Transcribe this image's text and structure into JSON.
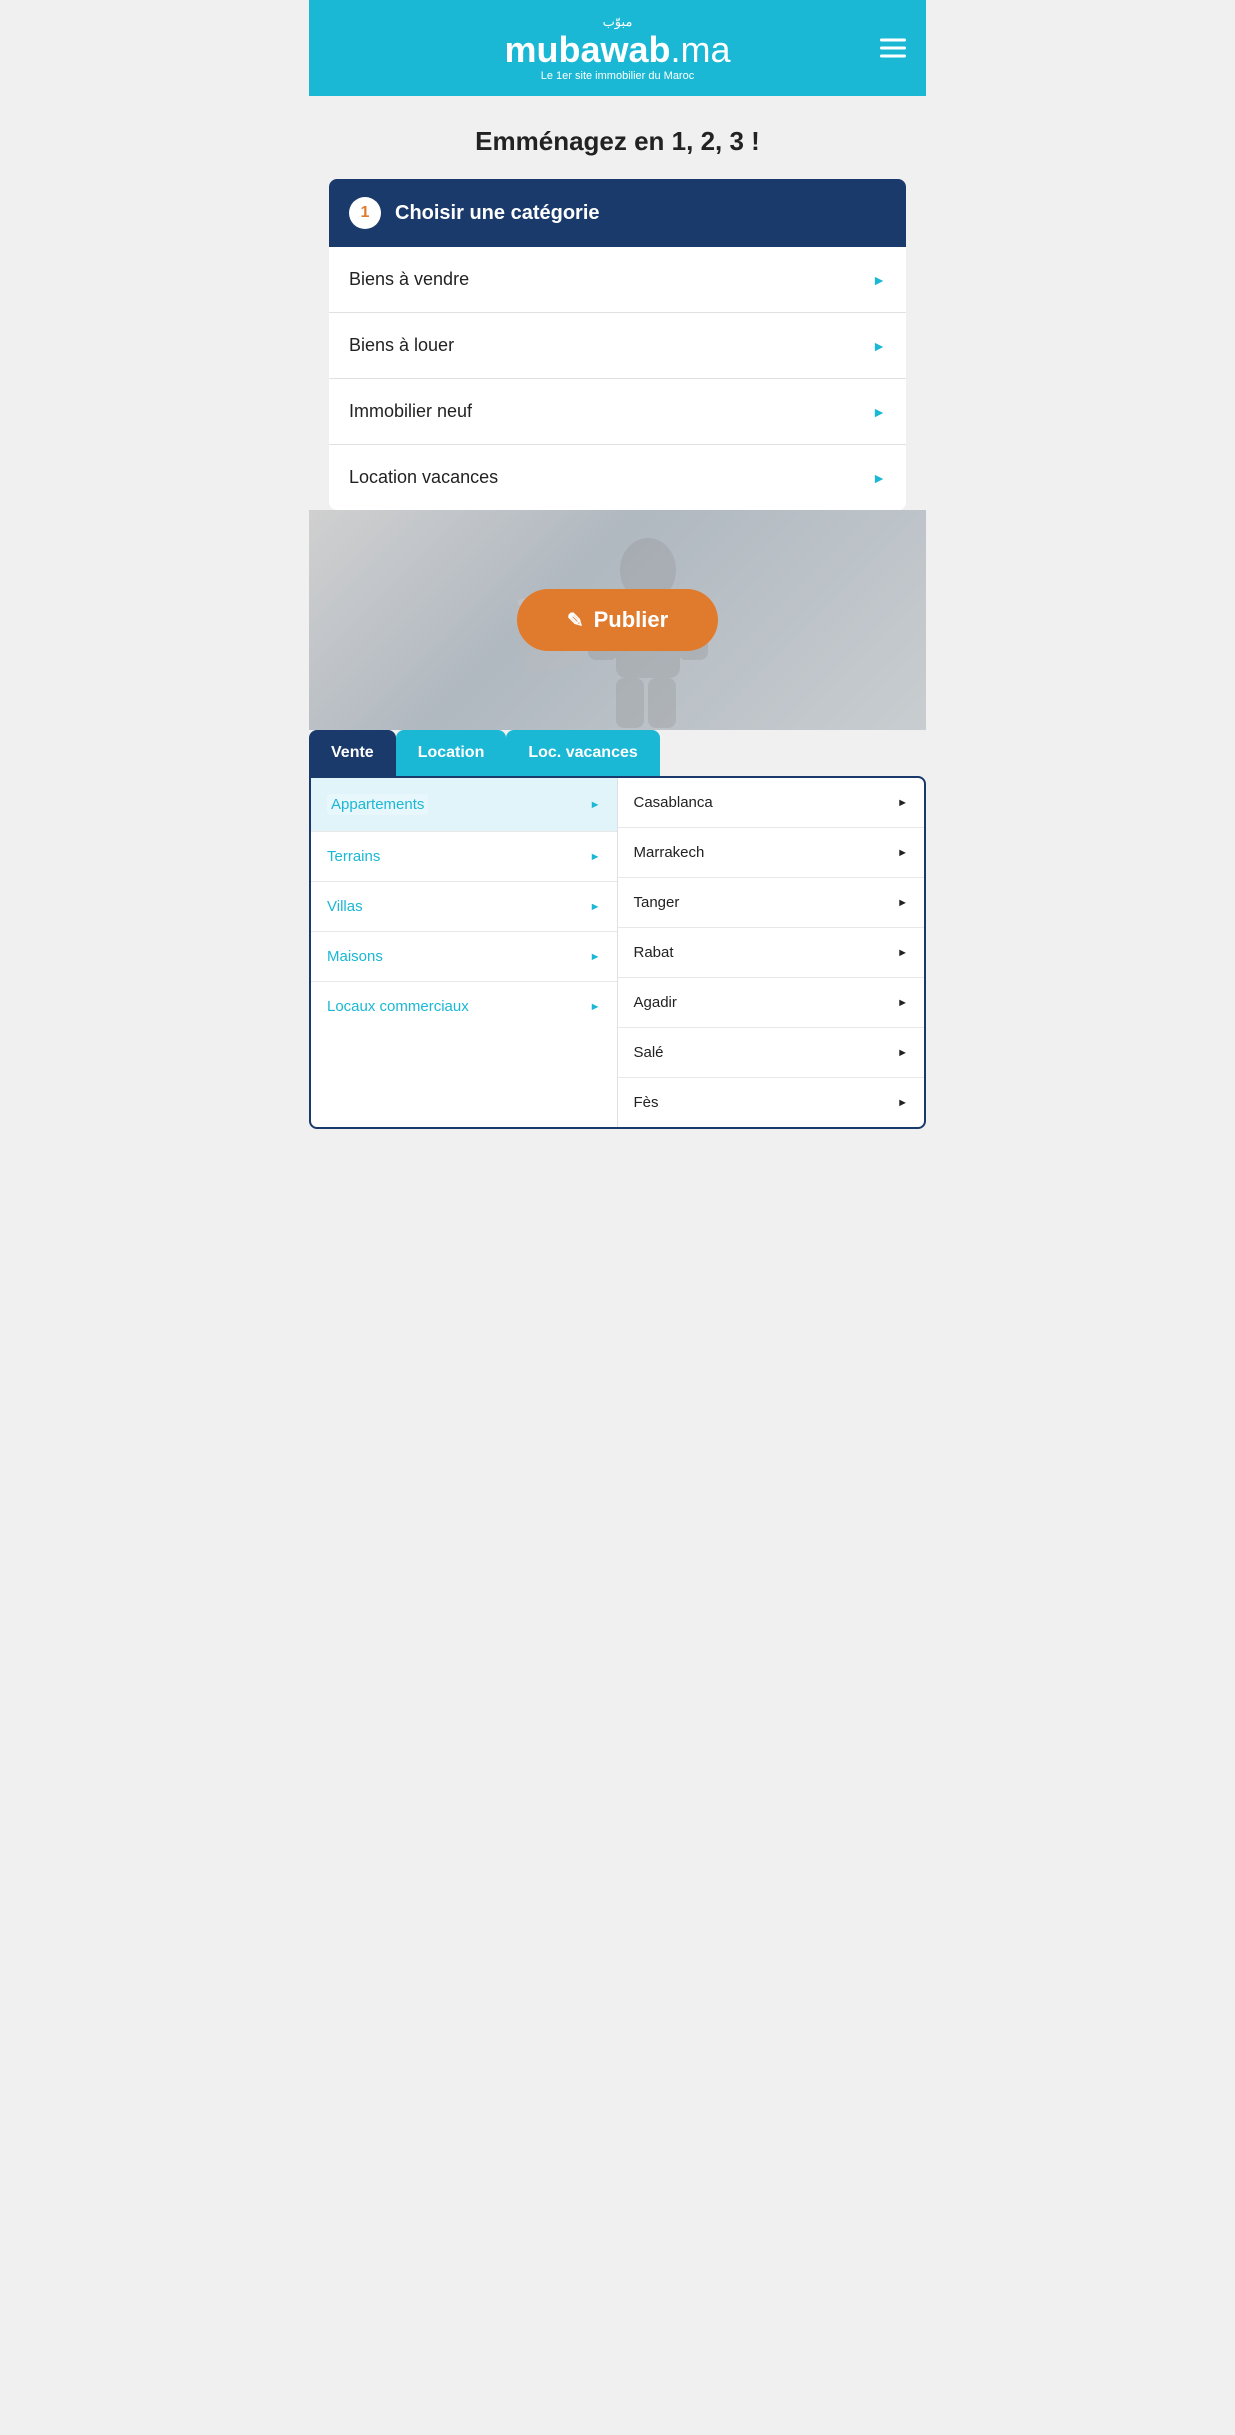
{
  "header": {
    "arabic_text": "مبوّب",
    "brand_text": "mubawab",
    "brand_suffix": ".ma",
    "tagline": "Le 1er site immobilier du Maroc",
    "menu_label": "Menu"
  },
  "page": {
    "title": "Emménagez en 1, 2, 3 !"
  },
  "category_section": {
    "step_number": "1",
    "step_label": "Choisir une catégorie",
    "items": [
      {
        "label": "Biens à vendre"
      },
      {
        "label": "Biens à louer"
      },
      {
        "label": "Immobilier neuf"
      },
      {
        "label": "Location vacances"
      }
    ]
  },
  "publish_button": {
    "label": "Publier"
  },
  "search_tabs": [
    {
      "label": "Vente",
      "active": true
    },
    {
      "label": "Location",
      "active": false
    },
    {
      "label": "Loc. vacances",
      "active": false
    }
  ],
  "search_grid": {
    "left_col": [
      {
        "label": "Appartements",
        "active": true
      },
      {
        "label": "Terrains",
        "active": false
      },
      {
        "label": "Villas",
        "active": false
      },
      {
        "label": "Maisons",
        "active": false
      },
      {
        "label": "Locaux commerciaux",
        "active": false
      }
    ],
    "right_col": [
      {
        "label": "Casablanca"
      },
      {
        "label": "Marrakech"
      },
      {
        "label": "Tanger"
      },
      {
        "label": "Rabat"
      },
      {
        "label": "Agadir"
      },
      {
        "label": "Salé"
      },
      {
        "label": "Fès"
      }
    ]
  }
}
